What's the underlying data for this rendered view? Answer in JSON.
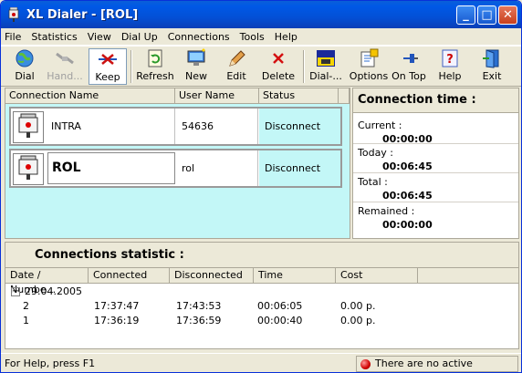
{
  "window": {
    "title": "XL Dialer - [ROL]",
    "minimize": "_",
    "maximize": "□",
    "close": "✕"
  },
  "menu": [
    "File",
    "Statistics",
    "View",
    "Dial Up",
    "Connections",
    "Tools",
    "Help"
  ],
  "toolbar": {
    "dial": "Dial",
    "hangup": "Hand...",
    "keep": "Keep",
    "refresh": "Refresh",
    "new": "New",
    "edit": "Edit",
    "delete": "Delete",
    "dialx": "Dial-...",
    "options": "Options",
    "ontop": "On Top",
    "help": "Help",
    "exit": "Exit"
  },
  "connections": {
    "headers": [
      "Connection Name",
      "User Name",
      "Status"
    ],
    "rows": [
      {
        "name": "INTRA",
        "user": "54636",
        "status": "Disconnect"
      },
      {
        "name": "ROL",
        "user": "rol",
        "status": "Disconnect"
      }
    ]
  },
  "connection_time": {
    "title": "Connection time :",
    "current_label": "Current :",
    "current": "00:00:00",
    "today_label": "Today :",
    "today": "00:06:45",
    "total_label": "Total :",
    "total": "00:06:45",
    "remained_label": "Remained :",
    "remained": "00:00:00"
  },
  "statistics": {
    "title": "Connections statistic :",
    "headers": [
      "Date / Numbe...",
      "Connected",
      "Disconnected",
      "Time",
      "Cost"
    ],
    "group": {
      "toggle": "−",
      "date": "29.04.2005"
    },
    "rows": [
      {
        "num": "2",
        "connected": "17:37:47",
        "disconnected": "17:43:53",
        "time": "00:06:05",
        "cost": "0.00 p."
      },
      {
        "num": "1",
        "connected": "17:36:19",
        "disconnected": "17:36:59",
        "time": "00:00:40",
        "cost": "0.00 p."
      }
    ]
  },
  "status": {
    "help": "For Help, press F1",
    "connections": "There are no active connections"
  }
}
